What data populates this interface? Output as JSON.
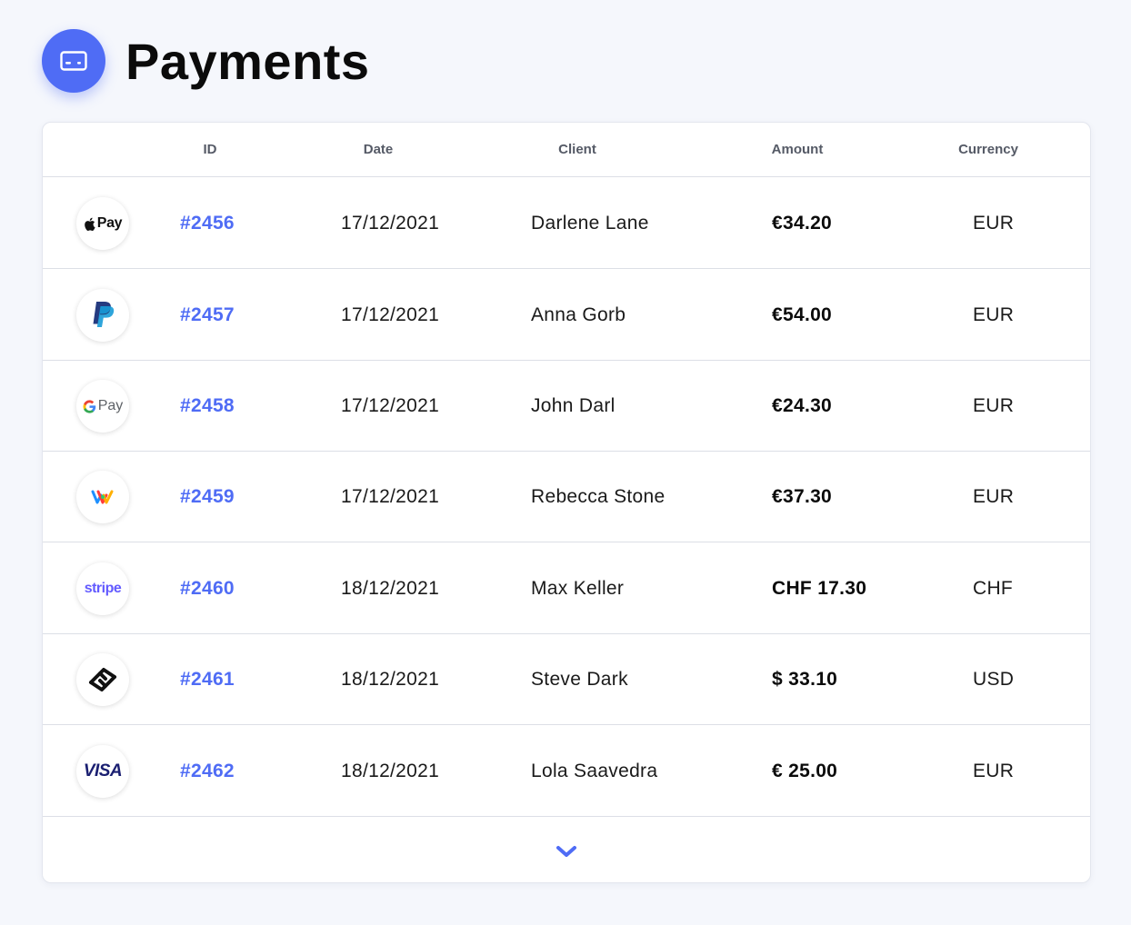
{
  "page": {
    "title": "Payments",
    "icon": "credit-card-icon",
    "accent": "#4f6cf5"
  },
  "table": {
    "columns": {
      "logo": "",
      "id": "ID",
      "date": "Date",
      "client": "Client",
      "amount": "Amount",
      "currency": "Currency"
    },
    "rows": [
      {
        "method": "apple-pay-logo",
        "logo_text": "Pay",
        "id": "#2456",
        "date": "17/12/2021",
        "client": "Darlene Lane",
        "amount": "€34.20",
        "currency": "EUR"
      },
      {
        "method": "paypal-logo",
        "logo_text": "",
        "id": "#2457",
        "date": "17/12/2021",
        "client": "Anna Gorb",
        "amount": "€54.00",
        "currency": "EUR"
      },
      {
        "method": "google-pay-logo",
        "logo_text": "Pay",
        "id": "#2458",
        "date": "17/12/2021",
        "client": "John Darl",
        "amount": "€24.30",
        "currency": "EUR"
      },
      {
        "method": "twint-logo",
        "logo_text": "",
        "id": "#2459",
        "date": "17/12/2021",
        "client": "Rebecca Stone",
        "amount": "€37.30",
        "currency": "EUR"
      },
      {
        "method": "stripe-logo",
        "logo_text": "stripe",
        "id": "#2460",
        "date": "18/12/2021",
        "client": "Max Keller",
        "amount": "CHF 17.30",
        "currency": "CHF"
      },
      {
        "method": "chain-link-logo",
        "logo_text": "",
        "id": "#2461",
        "date": "18/12/2021",
        "client": "Steve Dark",
        "amount": "$ 33.10",
        "currency": "USD"
      },
      {
        "method": "visa-logo",
        "logo_text": "VISA",
        "id": "#2462",
        "date": "18/12/2021",
        "client": "Lola Saavedra",
        "amount": "€ 25.00",
        "currency": "EUR"
      }
    ]
  },
  "footer": {
    "expand_icon": "chevron-down-icon"
  }
}
